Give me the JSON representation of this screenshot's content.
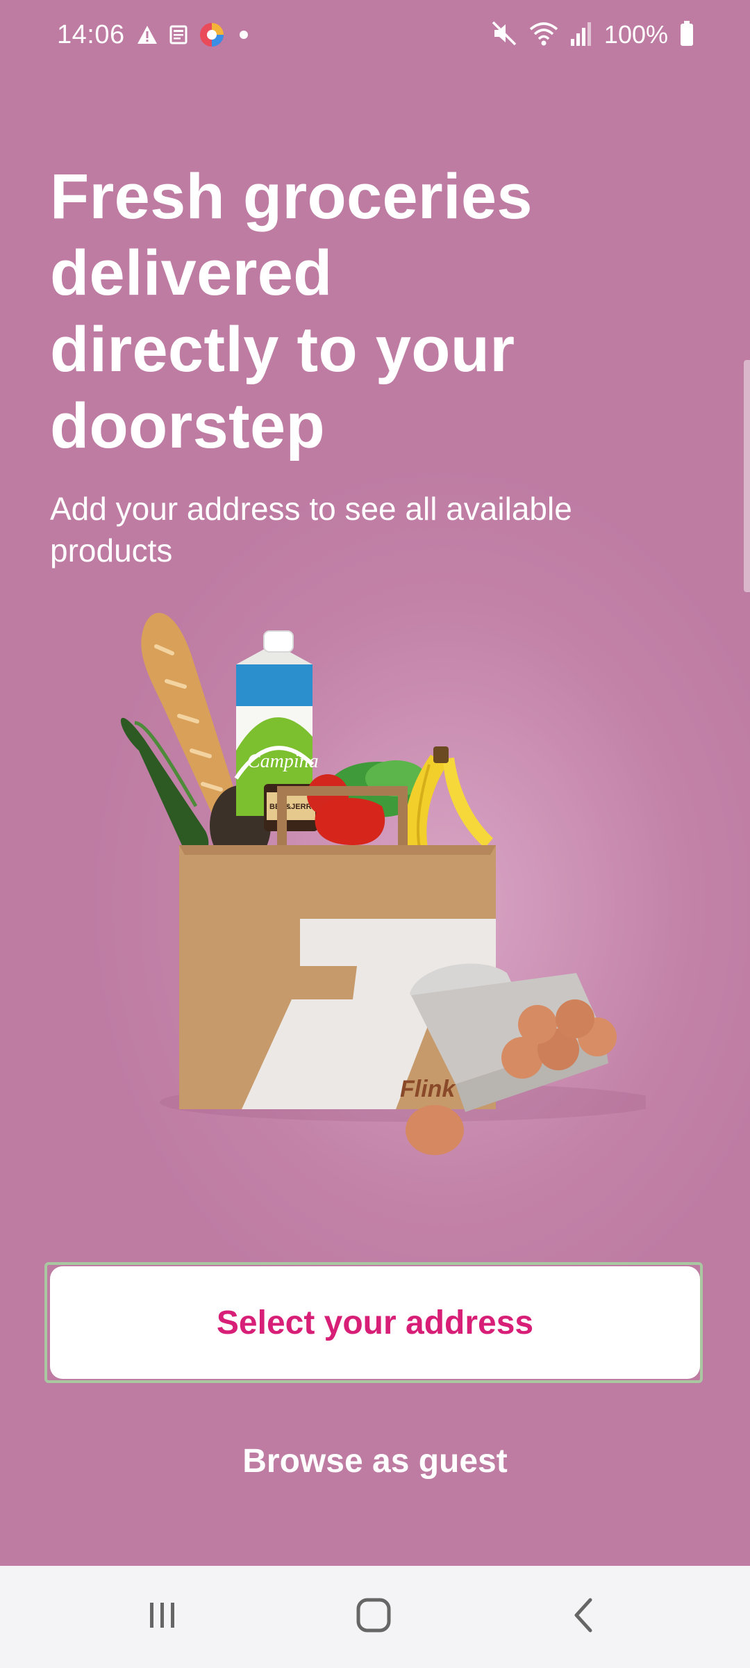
{
  "status_bar": {
    "time": "14:06",
    "battery_percent": "100%",
    "left_icons": [
      "alert-icon",
      "news-icon",
      "app-color-icon",
      "dot-icon"
    ],
    "right_icons": [
      "mute-icon",
      "wifi-icon",
      "signal-icon",
      "battery-icon"
    ]
  },
  "onboarding": {
    "headline_lines": [
      "Fresh groceries",
      "delivered",
      "directly to your",
      "doorstep"
    ],
    "subtitle": "Add your address to see all available products",
    "bag_brand": "Flink",
    "milk_brand": "Campina",
    "icecream_brand": "BEN&JERRY'S"
  },
  "actions": {
    "primary_label": "Select your address",
    "secondary_label": "Browse as guest"
  },
  "nav": {
    "items": [
      "recent-apps-icon",
      "home-icon",
      "back-icon"
    ]
  },
  "colors": {
    "background": "#c07ea3",
    "primary_text": "#d81f78",
    "button_bg": "#ffffff",
    "focus_ring": "#a9c7a0",
    "nav_bg": "#f4f4f6"
  }
}
